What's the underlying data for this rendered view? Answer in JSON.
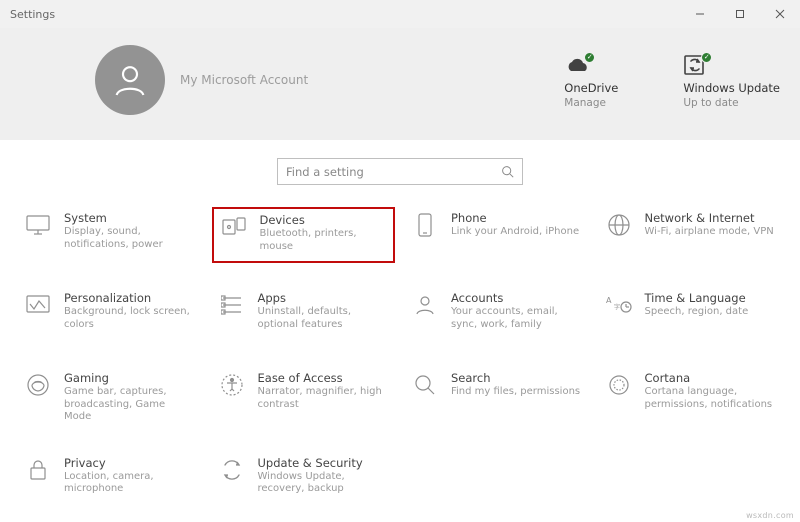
{
  "window": {
    "title": "Settings"
  },
  "account": {
    "name": "My Microsoft Account"
  },
  "header_tiles": {
    "onedrive": {
      "title": "OneDrive",
      "sub": "Manage"
    },
    "update": {
      "title": "Windows Update",
      "sub": "Up to date"
    }
  },
  "search": {
    "placeholder": "Find a setting"
  },
  "categories": {
    "system": {
      "title": "System",
      "desc": "Display, sound, notifications, power"
    },
    "devices": {
      "title": "Devices",
      "desc": "Bluetooth, printers, mouse"
    },
    "phone": {
      "title": "Phone",
      "desc": "Link your Android, iPhone"
    },
    "network": {
      "title": "Network & Internet",
      "desc": "Wi-Fi, airplane mode, VPN"
    },
    "personalization": {
      "title": "Personalization",
      "desc": "Background, lock screen, colors"
    },
    "apps": {
      "title": "Apps",
      "desc": "Uninstall, defaults, optional features"
    },
    "accounts": {
      "title": "Accounts",
      "desc": "Your accounts, email, sync, work, family"
    },
    "time": {
      "title": "Time & Language",
      "desc": "Speech, region, date"
    },
    "gaming": {
      "title": "Gaming",
      "desc": "Game bar, captures, broadcasting, Game Mode"
    },
    "ease": {
      "title": "Ease of Access",
      "desc": "Narrator, magnifier, high contrast"
    },
    "search_cat": {
      "title": "Search",
      "desc": "Find my files, permissions"
    },
    "cortana": {
      "title": "Cortana",
      "desc": "Cortana language, permissions, notifications"
    },
    "privacy": {
      "title": "Privacy",
      "desc": "Location, camera, microphone"
    },
    "update_sec": {
      "title": "Update & Security",
      "desc": "Windows Update, recovery, backup"
    }
  },
  "watermark": "wsxdn.com"
}
